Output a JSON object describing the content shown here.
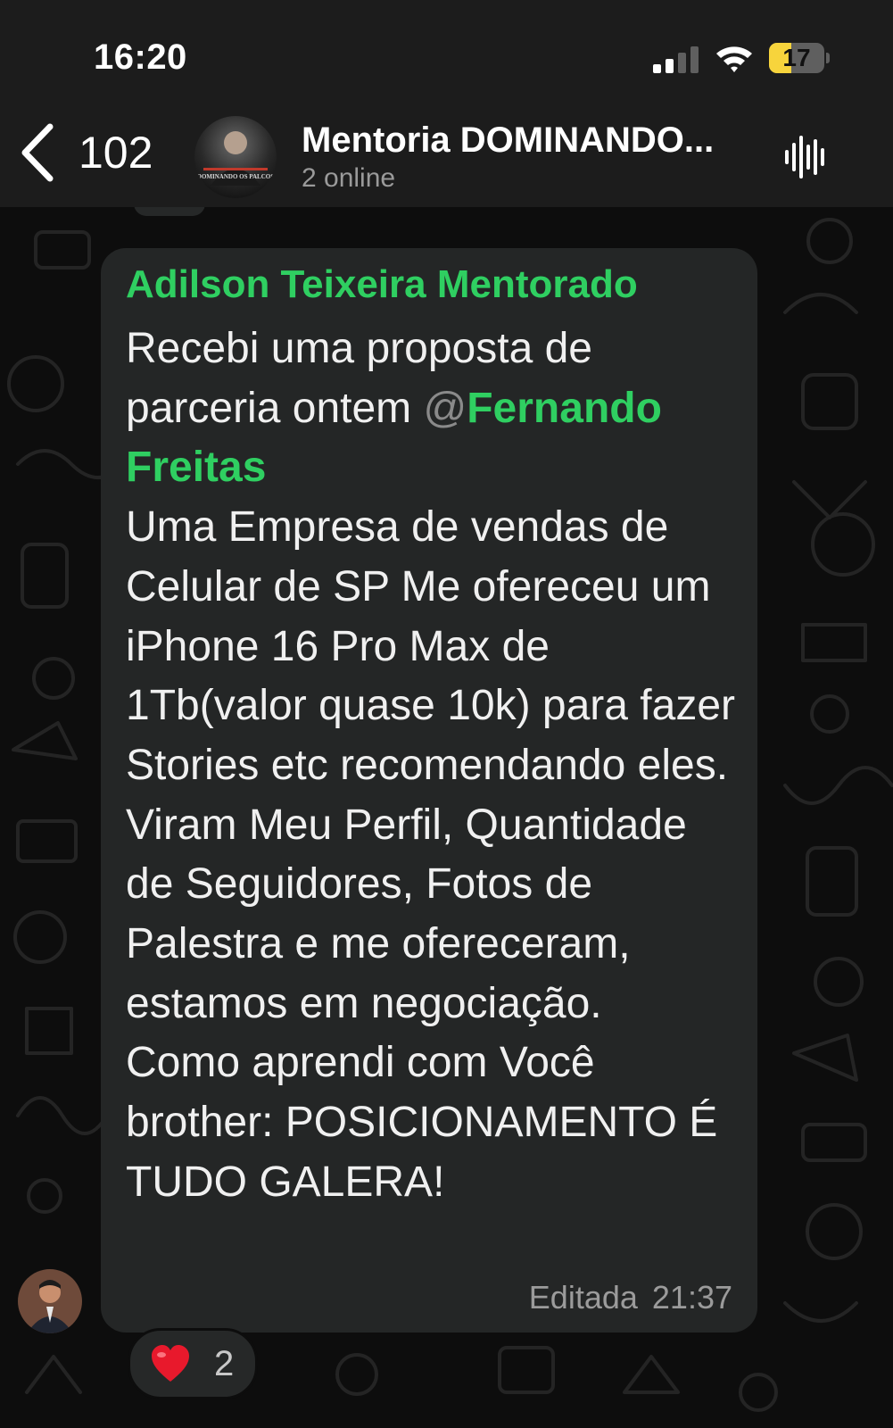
{
  "status_bar": {
    "time": "16:20",
    "battery_level": "17",
    "battery_fraction": 0.17,
    "signal_bars_active": 2,
    "signal_bars_total": 4
  },
  "header": {
    "back_count": "102",
    "group_name": "Mentoria DOMINANDO...",
    "online_status": "2 online",
    "avatar_caption": "DOMINANDO OS PALCOS"
  },
  "message": {
    "sender": "Adilson Teixeira Mentorado",
    "text_intro": "Recebi uma proposta de parceria ontem ",
    "mention_at": "@",
    "mention_name": "Fernando Freitas",
    "text_body": "Uma Empresa de vendas de Celular de SP Me ofereceu um iPhone 16 Pro Max de 1Tb(valor quase 10k) para fazer Stories etc recomendando eles.\nViram Meu Perfil, Quantidade de Seguidores, Fotos de Palestra e me ofereceram, estamos em negociação.\nComo aprendi com Você brother: POSICIONAMENTO É TUDO GALERA!",
    "edited_label": "Editada",
    "time": "21:37"
  },
  "reaction": {
    "emoji": "heart-icon",
    "count": "2"
  },
  "colors": {
    "accent_green": "#2fcf61",
    "bubble": "#242626",
    "header": "#1c1c1c",
    "battery": "#f7d43c",
    "heart": "#e8192c"
  }
}
